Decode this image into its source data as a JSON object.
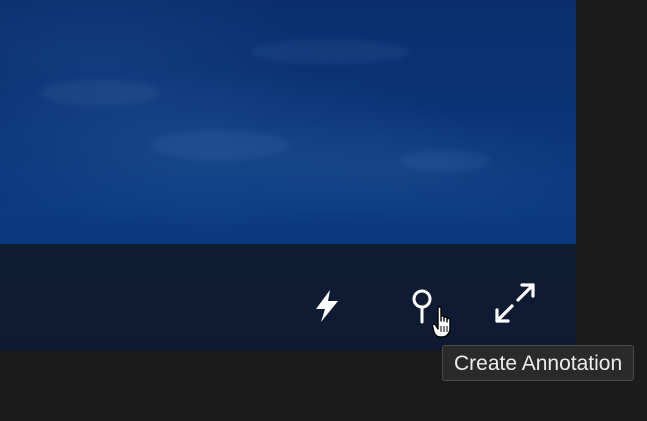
{
  "player": {
    "controls": {
      "flash_icon": "lightning-bolt",
      "annotation_icon": "map-pin",
      "fullscreen_icon": "expand-arrows"
    },
    "tooltip": {
      "text": "Create Annotation"
    }
  },
  "colors": {
    "background": "#1b1b1b",
    "video_tint": "#0a3478",
    "control_bar": "#121418",
    "icon": "#ffffff",
    "tooltip_bg": "#2a2a2a",
    "tooltip_text": "#ececec"
  }
}
